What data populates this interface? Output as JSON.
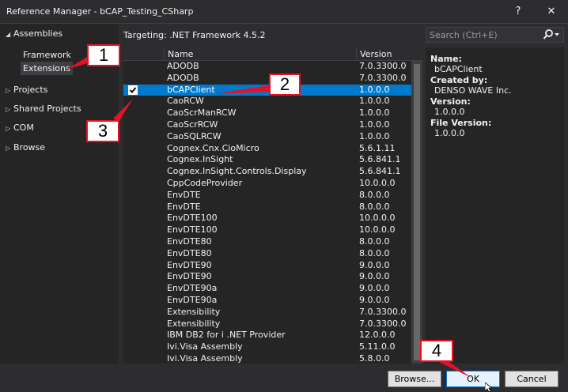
{
  "window": {
    "title": "Reference Manager - bCAP_Testing_CSharp",
    "help_label": "?",
    "close_label": "✕"
  },
  "left_nav": {
    "root_items": [
      {
        "label": "Assemblies",
        "expanded": true
      },
      {
        "label": "Projects",
        "expanded": false
      },
      {
        "label": "Shared Projects",
        "expanded": false
      },
      {
        "label": "COM",
        "expanded": false
      },
      {
        "label": "Browse",
        "expanded": false
      }
    ],
    "sub_items": [
      {
        "label": "Framework"
      },
      {
        "label": "Extensions",
        "selected": true
      }
    ]
  },
  "targeting": "Targeting: .NET Framework 4.5.2",
  "search": {
    "placeholder": "Search (Ctrl+E)"
  },
  "list": {
    "columns": [
      "Name",
      "Version"
    ],
    "rows": [
      {
        "name": "ADODB",
        "version": "7.0.3300.0",
        "checked": false,
        "selected": false
      },
      {
        "name": "ADODB",
        "version": "7.0.3300.0",
        "checked": false,
        "selected": false
      },
      {
        "name": "bCAPClient",
        "version": "1.0.0.0",
        "checked": true,
        "selected": true
      },
      {
        "name": "CaoRCW",
        "version": "1.0.0.0",
        "checked": false,
        "selected": false
      },
      {
        "name": "CaoScrManRCW",
        "version": "1.0.0.0",
        "checked": false,
        "selected": false
      },
      {
        "name": "CaoScrRCW",
        "version": "1.0.0.0",
        "checked": false,
        "selected": false
      },
      {
        "name": "CaoSQLRCW",
        "version": "1.0.0.0",
        "checked": false,
        "selected": false
      },
      {
        "name": "Cognex.Cnx.CioMicro",
        "version": "5.6.1.11",
        "checked": false,
        "selected": false
      },
      {
        "name": "Cognex.InSight",
        "version": "5.6.841.1",
        "checked": false,
        "selected": false
      },
      {
        "name": "Cognex.InSight.Controls.Display",
        "version": "5.6.841.1",
        "checked": false,
        "selected": false
      },
      {
        "name": "CppCodeProvider",
        "version": "10.0.0.0",
        "checked": false,
        "selected": false
      },
      {
        "name": "EnvDTE",
        "version": "8.0.0.0",
        "checked": false,
        "selected": false
      },
      {
        "name": "EnvDTE",
        "version": "8.0.0.0",
        "checked": false,
        "selected": false
      },
      {
        "name": "EnvDTE100",
        "version": "10.0.0.0",
        "checked": false,
        "selected": false
      },
      {
        "name": "EnvDTE100",
        "version": "10.0.0.0",
        "checked": false,
        "selected": false
      },
      {
        "name": "EnvDTE80",
        "version": "8.0.0.0",
        "checked": false,
        "selected": false
      },
      {
        "name": "EnvDTE80",
        "version": "8.0.0.0",
        "checked": false,
        "selected": false
      },
      {
        "name": "EnvDTE90",
        "version": "9.0.0.0",
        "checked": false,
        "selected": false
      },
      {
        "name": "EnvDTE90",
        "version": "9.0.0.0",
        "checked": false,
        "selected": false
      },
      {
        "name": "EnvDTE90a",
        "version": "9.0.0.0",
        "checked": false,
        "selected": false
      },
      {
        "name": "EnvDTE90a",
        "version": "9.0.0.0",
        "checked": false,
        "selected": false
      },
      {
        "name": "Extensibility",
        "version": "7.0.3300.0",
        "checked": false,
        "selected": false
      },
      {
        "name": "Extensibility",
        "version": "7.0.3300.0",
        "checked": false,
        "selected": false
      },
      {
        "name": "IBM DB2 for i .NET Provider",
        "version": "12.0.0.0",
        "checked": false,
        "selected": false
      },
      {
        "name": "Ivi.Visa Assembly",
        "version": "5.11.0.0",
        "checked": false,
        "selected": false
      },
      {
        "name": "Ivi.Visa Assembly",
        "version": "5.8.0.0",
        "checked": false,
        "selected": false
      }
    ]
  },
  "details": {
    "name_label": "Name:",
    "name_value": "bCAPClient",
    "created_by_label": "Created by:",
    "created_by_value": "DENSO WAVE Inc.",
    "version_label": "Version:",
    "version_value": "1.0.0.0",
    "file_version_label": "File Version:",
    "file_version_value": "1.0.0.0"
  },
  "buttons": {
    "browse": "Browse...",
    "ok": "OK",
    "cancel": "Cancel"
  },
  "callouts": [
    "1",
    "2",
    "3",
    "4"
  ],
  "colors": {
    "selection": "#007acc",
    "callout_border": "#e81123"
  }
}
